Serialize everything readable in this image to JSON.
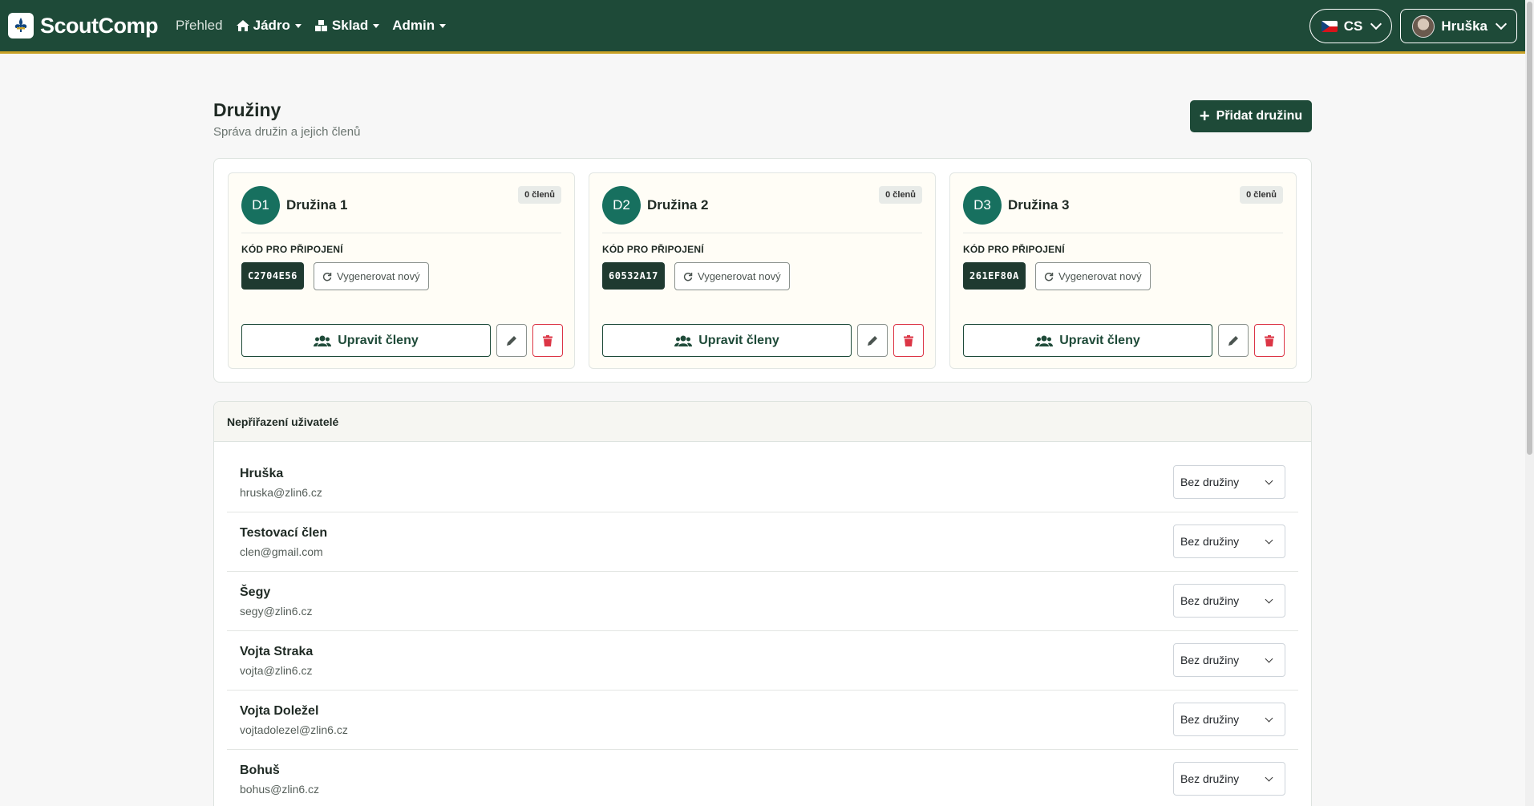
{
  "nav": {
    "brand": "ScoutComp",
    "items": [
      {
        "label": "Přehled"
      },
      {
        "label": "Jádro"
      },
      {
        "label": "Sklad"
      },
      {
        "label": "Admin"
      }
    ],
    "language": "CS",
    "user": "Hruška"
  },
  "page": {
    "title": "Družiny",
    "subtitle": "Správa družin a jejich členů",
    "add_button": "Přidat družinu"
  },
  "groups": [
    {
      "abbr": "D1",
      "name": "Družina 1",
      "members_badge": "0 členů",
      "code_label": "KÓD PRO PŘIPOJENÍ",
      "code": "C2704E56",
      "regen_label": "Vygenerovat nový",
      "edit_label": "Upravit členy"
    },
    {
      "abbr": "D2",
      "name": "Družina 2",
      "members_badge": "0 členů",
      "code_label": "KÓD PRO PŘIPOJENÍ",
      "code": "60532A17",
      "regen_label": "Vygenerovat nový",
      "edit_label": "Upravit členy"
    },
    {
      "abbr": "D3",
      "name": "Družina 3",
      "members_badge": "0 členů",
      "code_label": "KÓD PRO PŘIPOJENÍ",
      "code": "261EF80A",
      "regen_label": "Vygenerovat nový",
      "edit_label": "Upravit členy"
    }
  ],
  "unassigned": {
    "title": "Nepřiřazení uživatelé",
    "users": [
      {
        "name": "Hruška",
        "email": "hruska@zlin6.cz",
        "select": "Bez družiny"
      },
      {
        "name": "Testovací člen",
        "email": "clen@gmail.com",
        "select": "Bez družiny"
      },
      {
        "name": "Šegy",
        "email": "segy@zlin6.cz",
        "select": "Bez družiny"
      },
      {
        "name": "Vojta Straka",
        "email": "vojta@zlin6.cz",
        "select": "Bez družiny"
      },
      {
        "name": "Vojta Doležel",
        "email": "vojtadolezel@zlin6.cz",
        "select": "Bez družiny"
      },
      {
        "name": "Bohuš",
        "email": "bohus@zlin6.cz",
        "select": "Bez družiny"
      }
    ]
  },
  "colors": {
    "primary": "#1e4a38",
    "accent": "#c9a227",
    "circle": "#17705f",
    "danger": "#dc3545"
  }
}
